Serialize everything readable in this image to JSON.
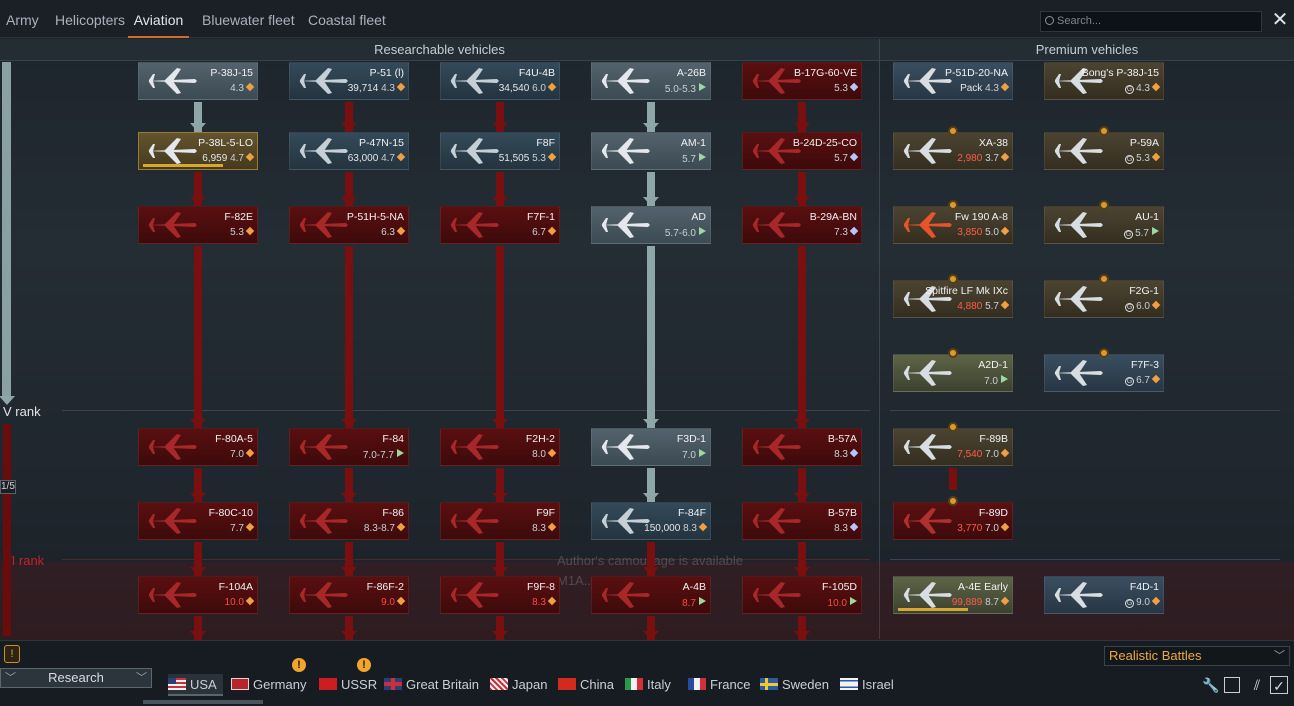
{
  "top_tabs": [
    "Army",
    "Helicopters",
    "Aviation",
    "Bluewater fleet",
    "Coastal fleet"
  ],
  "active_tab": "Aviation",
  "search": {
    "placeholder": "Search..."
  },
  "sections": {
    "researchable": "Researchable vehicles",
    "premium": "Premium vehicles"
  },
  "ranks": {
    "five": "V rank",
    "six": "VI rank"
  },
  "progress_text": "1/5",
  "ghost_text": {
    "line1": "Author's camouflage is available",
    "line2": "M1A... ...er"
  },
  "researchable": [
    {
      "name": "P-38J-15",
      "br": "4.3",
      "rp": "",
      "icon": "o",
      "state": "researched"
    },
    {
      "name": "P-51 (l)",
      "br": "4.3",
      "rp": "39,714",
      "icon": "o",
      "state": "avail"
    },
    {
      "name": "F4U-4B",
      "br": "6.0",
      "rp": "34,540",
      "icon": "o",
      "state": "avail"
    },
    {
      "name": "A-26B",
      "br": "5.0-5.3",
      "rp": "",
      "icon": "g",
      "state": "researched"
    },
    {
      "name": "B-17G-60-VE",
      "br": "5.3",
      "rp": "",
      "icon": "b",
      "state": "locked"
    },
    {
      "name": "P-38L-5-LO",
      "br": "4.7",
      "rp": "6,959",
      "icon": "o",
      "state": "progress"
    },
    {
      "name": "P-47N-15",
      "br": "4.7",
      "rp": "63,000",
      "icon": "o",
      "state": "avail"
    },
    {
      "name": "F8F",
      "br": "5.3",
      "rp": "51,505",
      "icon": "o",
      "state": "avail"
    },
    {
      "name": "AM-1",
      "br": "5.7",
      "rp": "",
      "icon": "g",
      "state": "researched"
    },
    {
      "name": "B-24D-25-CO",
      "br": "5.7",
      "rp": "",
      "icon": "b",
      "state": "locked"
    },
    {
      "name": "F-82E",
      "br": "5.3",
      "rp": "",
      "icon": "o",
      "state": "locked"
    },
    {
      "name": "P-51H-5-NA",
      "br": "6.3",
      "rp": "",
      "icon": "o",
      "state": "locked"
    },
    {
      "name": "F7F-1",
      "br": "6.7",
      "rp": "",
      "icon": "o",
      "state": "locked"
    },
    {
      "name": "AD",
      "br": "5.7-6.0",
      "rp": "",
      "icon": "g",
      "state": "researched"
    },
    {
      "name": "B-29A-BN",
      "br": "7.3",
      "rp": "",
      "icon": "b",
      "state": "locked"
    },
    {
      "name": "F-80A-5",
      "br": "7.0",
      "rp": "",
      "icon": "o",
      "state": "locked"
    },
    {
      "name": "F-84",
      "br": "7.0-7.7",
      "rp": "",
      "icon": "g",
      "state": "locked"
    },
    {
      "name": "F2H-2",
      "br": "8.0",
      "rp": "",
      "icon": "o",
      "state": "locked"
    },
    {
      "name": "F3D-1",
      "br": "7.0",
      "rp": "",
      "icon": "g",
      "state": "researched"
    },
    {
      "name": "B-57A",
      "br": "8.3",
      "rp": "",
      "icon": "b",
      "state": "locked"
    },
    {
      "name": "F-80C-10",
      "br": "7.7",
      "rp": "",
      "icon": "o",
      "state": "locked"
    },
    {
      "name": "F-86",
      "br": "8.3-8.7",
      "rp": "",
      "icon": "o",
      "state": "locked"
    },
    {
      "name": "F9F",
      "br": "8.3",
      "rp": "",
      "icon": "o",
      "state": "locked"
    },
    {
      "name": "F-84F",
      "br": "8.3",
      "rp": "150,000",
      "icon": "o",
      "state": "avail"
    },
    {
      "name": "B-57B",
      "br": "8.3",
      "rp": "",
      "icon": "b",
      "state": "locked"
    },
    {
      "name": "F-104A",
      "br": "10.0",
      "rp": "",
      "icon": "o",
      "state": "locked",
      "red": true
    },
    {
      "name": "F-86F-2",
      "br": "9.0",
      "rp": "",
      "icon": "o",
      "state": "locked",
      "red": true
    },
    {
      "name": "F9F-8",
      "br": "8.3",
      "rp": "",
      "icon": "o",
      "state": "locked",
      "red": true
    },
    {
      "name": "A-4B",
      "br": "8.7",
      "rp": "",
      "icon": "g",
      "state": "locked",
      "red": true
    },
    {
      "name": "F-105D",
      "br": "10.0",
      "rp": "",
      "icon": "g",
      "state": "locked",
      "red": true
    }
  ],
  "premium": [
    {
      "name": "P-51D-20-NA",
      "br": "4.3",
      "price": "Pack",
      "icon": "o",
      "style": "premium-blue"
    },
    {
      "name": "Bong's P-38J-15",
      "br": "4.3",
      "price": "G",
      "icon": "o",
      "style": "premium"
    },
    {
      "name": "XA-38",
      "br": "3.7",
      "price": "2,980",
      "icon": "o",
      "style": "premium"
    },
    {
      "name": "P-59A",
      "br": "5.3",
      "price": "G",
      "icon": "o",
      "style": "premium"
    },
    {
      "name": "Fw 190 A-8",
      "br": "5.0",
      "price": "3,850",
      "icon": "o",
      "style": "premium"
    },
    {
      "name": "AU-1",
      "br": "5.7",
      "price": "G",
      "icon": "g",
      "style": "premium"
    },
    {
      "name": "Spitfire LF Mk IXc",
      "br": "5.7",
      "price": "4,880",
      "icon": "o",
      "style": "premium"
    },
    {
      "name": "F2G-1",
      "br": "6.0",
      "price": "G",
      "icon": "o",
      "style": "premium"
    },
    {
      "name": "A2D-1",
      "br": "7.0",
      "price": "",
      "icon": "g",
      "style": "premium-gold"
    },
    {
      "name": "F7F-3",
      "br": "6.7",
      "price": "G",
      "icon": "o",
      "style": "premium-blue"
    },
    {
      "name": "F-89B",
      "br": "7.0",
      "price": "7,540",
      "icon": "o",
      "style": "premium"
    },
    {
      "name": "F-89D",
      "br": "7.0",
      "price": "3,770",
      "icon": "o",
      "style": "premium-red"
    },
    {
      "name": "A-4E Early",
      "br": "8.7",
      "price": "99,889",
      "icon": "o",
      "style": "premium-gold"
    },
    {
      "name": "F4D-1",
      "br": "9.0",
      "price": "G",
      "icon": "o",
      "style": "premium-blue"
    }
  ],
  "research_button": "Research",
  "nations": [
    "USA",
    "Germany",
    "USSR",
    "Great Britain",
    "Japan",
    "China",
    "Italy",
    "France",
    "Sweden",
    "Israel"
  ],
  "game_mode": "Realistic Battles",
  "colors": {
    "accent": "#d26a2a",
    "locked": "#7a0f10",
    "researched": "#8fa6a8",
    "mode_text": "#f0a840"
  }
}
